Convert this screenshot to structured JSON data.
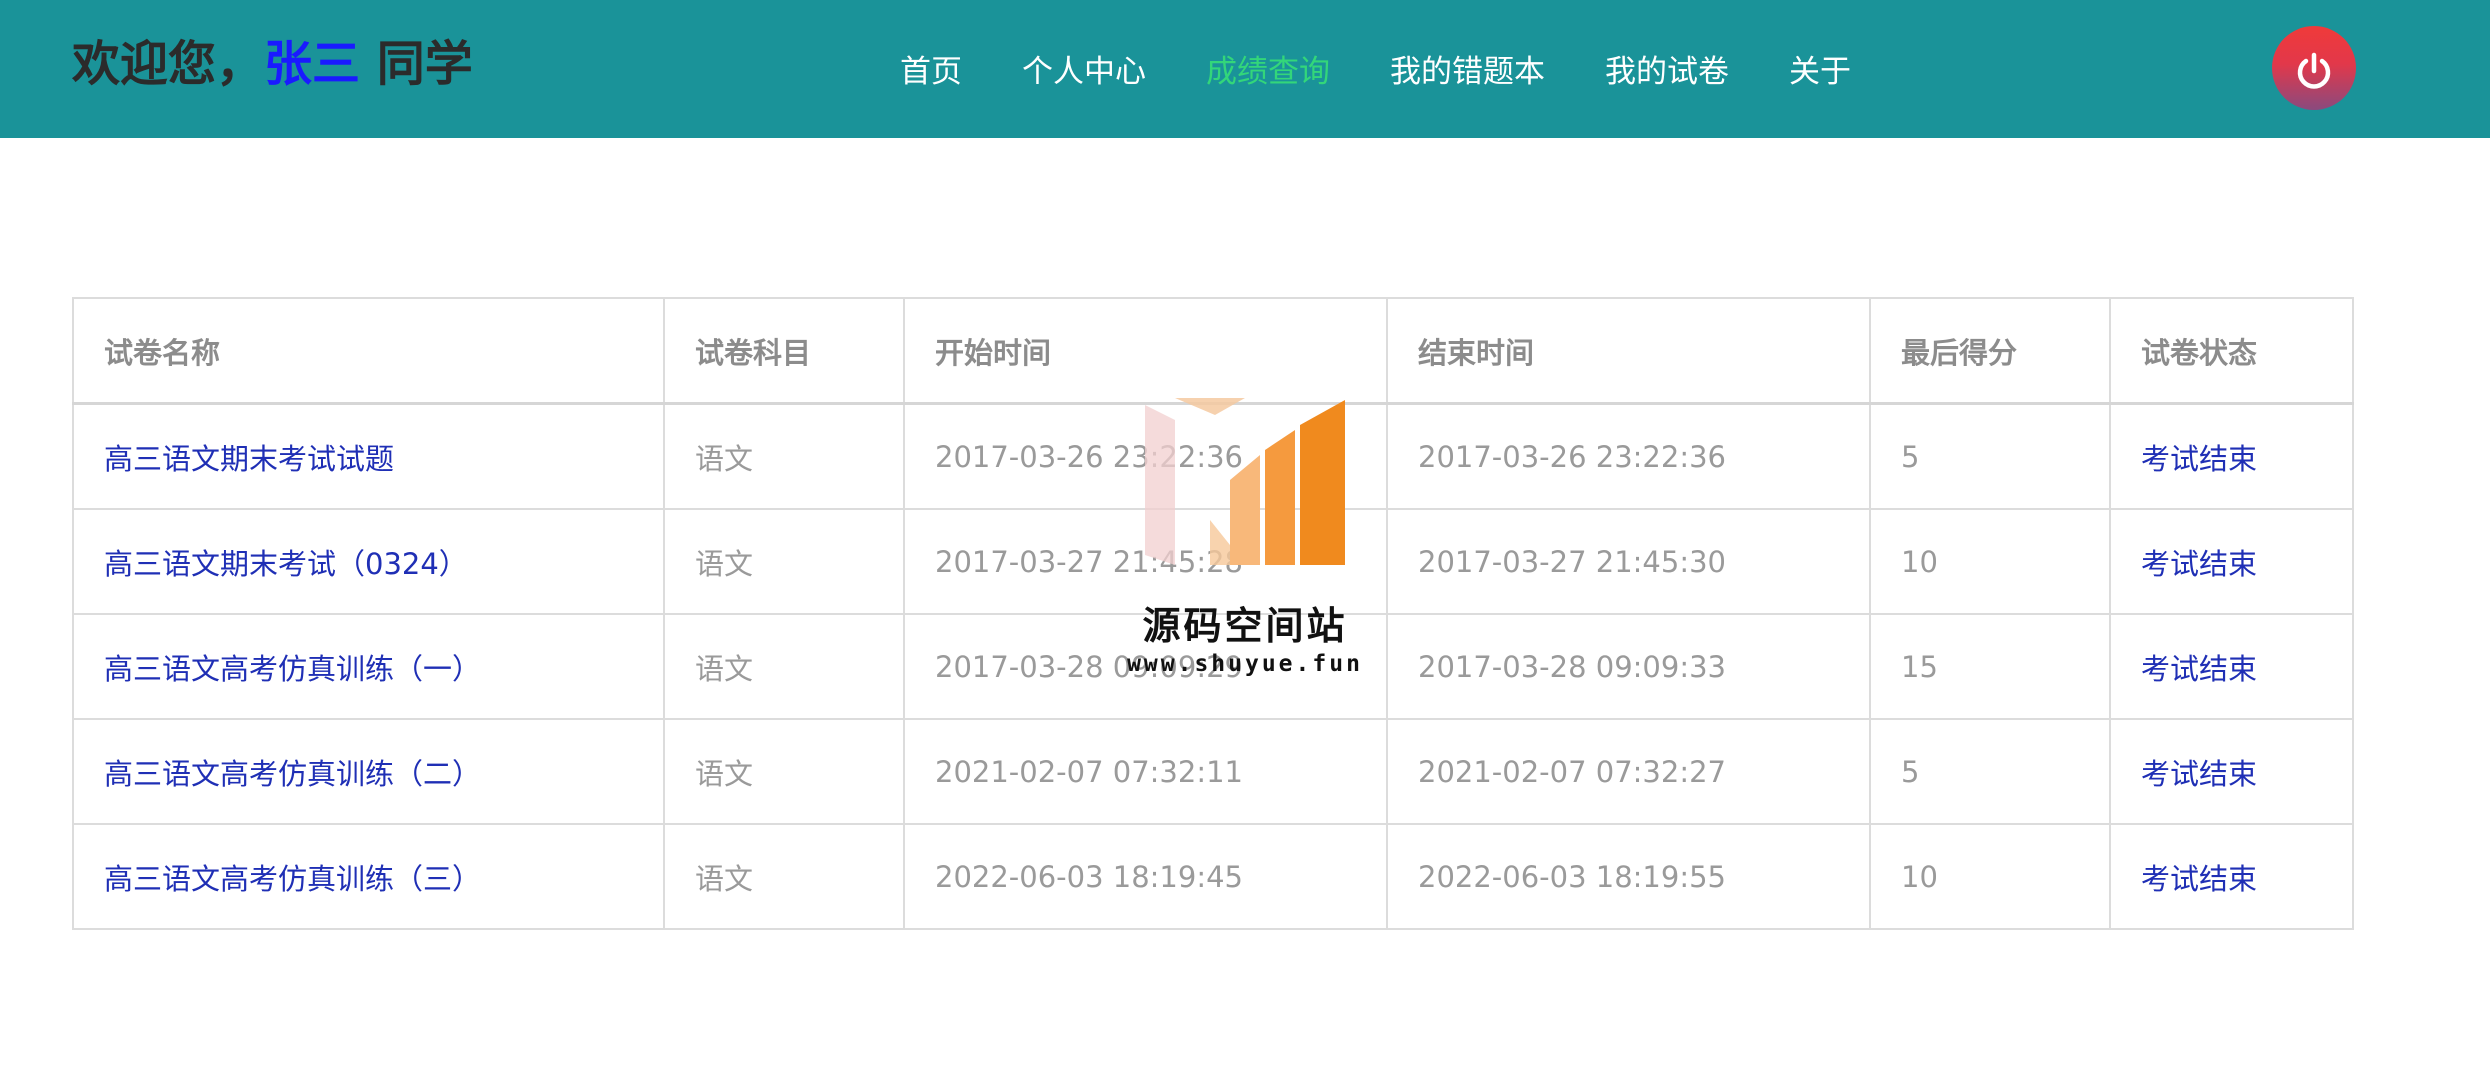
{
  "header": {
    "welcome_prefix": "欢迎您，",
    "user_name": "张三",
    "welcome_suffix": " 同学",
    "nav": [
      {
        "label": "首页",
        "active": false
      },
      {
        "label": "个人中心",
        "active": false
      },
      {
        "label": "成绩查询",
        "active": true
      },
      {
        "label": "我的错题本",
        "active": false
      },
      {
        "label": "我的试卷",
        "active": false
      },
      {
        "label": "关于",
        "active": false
      }
    ],
    "logout_icon": "power-icon",
    "colors": {
      "header_bg": "#1a9399",
      "active_nav": "#33d67a",
      "user_name": "#1a1aff",
      "link": "#1f2fb5"
    }
  },
  "table": {
    "columns": [
      "试卷名称",
      "试卷科目",
      "开始时间",
      "结束时间",
      "最后得分",
      "试卷状态"
    ],
    "rows": [
      {
        "name": "高三语文期末考试试题",
        "subject": "语文",
        "start": "2017-03-26 23:22:36",
        "end": "2017-03-26 23:22:36",
        "score": "5",
        "status": "考试结束"
      },
      {
        "name": "高三语文期末考试（0324）",
        "subject": "语文",
        "start": "2017-03-27 21:45:28",
        "end": "2017-03-27 21:45:30",
        "score": "10",
        "status": "考试结束"
      },
      {
        "name": "高三语文高考仿真训练（一）",
        "subject": "语文",
        "start": "2017-03-28 09:09:29",
        "end": "2017-03-28 09:09:33",
        "score": "15",
        "status": "考试结束"
      },
      {
        "name": "高三语文高考仿真训练（二）",
        "subject": "语文",
        "start": "2021-02-07 07:32:11",
        "end": "2021-02-07 07:32:27",
        "score": "5",
        "status": "考试结束"
      },
      {
        "name": "高三语文高考仿真训练（三）",
        "subject": "语文",
        "start": "2022-06-03 18:19:45",
        "end": "2022-06-03 18:19:55",
        "score": "10",
        "status": "考试结束"
      }
    ]
  },
  "watermark": {
    "title": "源码空间站",
    "url": "www.shuyue.fun"
  }
}
